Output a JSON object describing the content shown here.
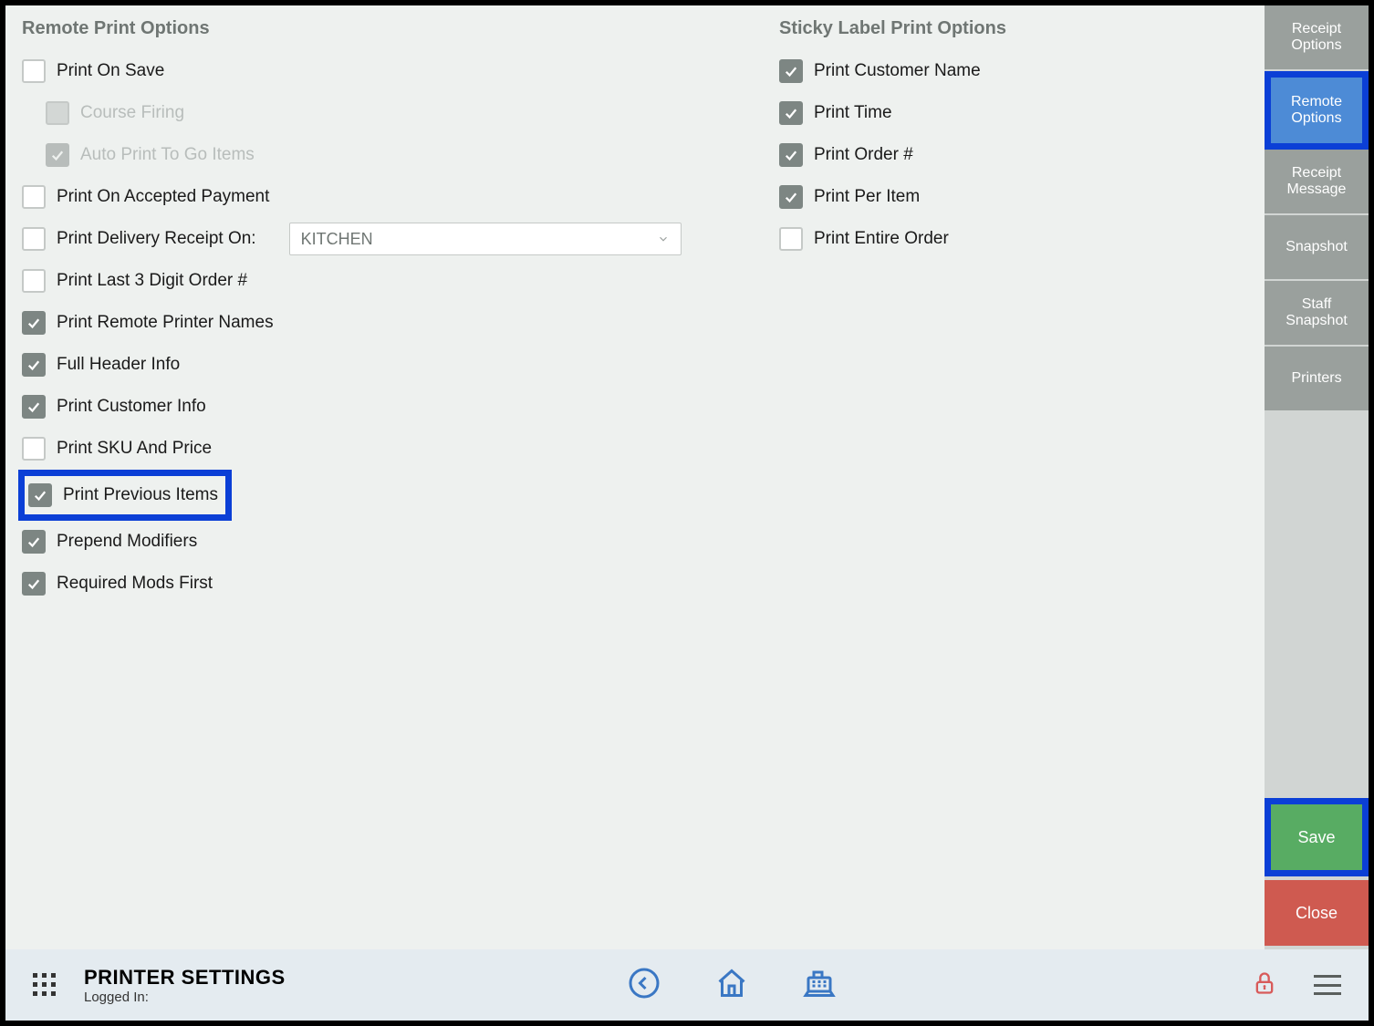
{
  "sections": {
    "remote_title": "Remote Print Options",
    "sticky_title": "Sticky Label Print Options"
  },
  "remote": {
    "print_on_save": "Print On Save",
    "course_firing": "Course Firing",
    "auto_print_togo": "Auto Print To Go Items",
    "print_on_accepted_payment": "Print On Accepted Payment",
    "print_delivery_receipt_on": "Print Delivery Receipt On:",
    "delivery_select_value": "KITCHEN",
    "print_last3": "Print Last 3 Digit Order #",
    "print_remote_printer_names": "Print Remote Printer Names",
    "full_header_info": "Full Header Info",
    "print_customer_info": "Print Customer Info",
    "print_sku_and_price": "Print SKU And Price",
    "print_previous_items": "Print Previous Items",
    "prepend_modifiers": "Prepend Modifiers",
    "required_mods_first": "Required Mods First"
  },
  "sticky": {
    "print_customer_name": "Print Customer Name",
    "print_time": "Print Time",
    "print_order_no": "Print Order #",
    "print_per_item": "Print Per Item",
    "print_entire_order": "Print Entire Order"
  },
  "sidebar": {
    "receipt_options": "Receipt Options",
    "remote_options": "Remote Options",
    "receipt_message": "Receipt Message",
    "snapshot": "Snapshot",
    "staff_snapshot": "Staff Snapshot",
    "printers": "Printers",
    "save": "Save",
    "close": "Close"
  },
  "footer": {
    "title": "PRINTER SETTINGS",
    "logged_in": "Logged In:"
  }
}
